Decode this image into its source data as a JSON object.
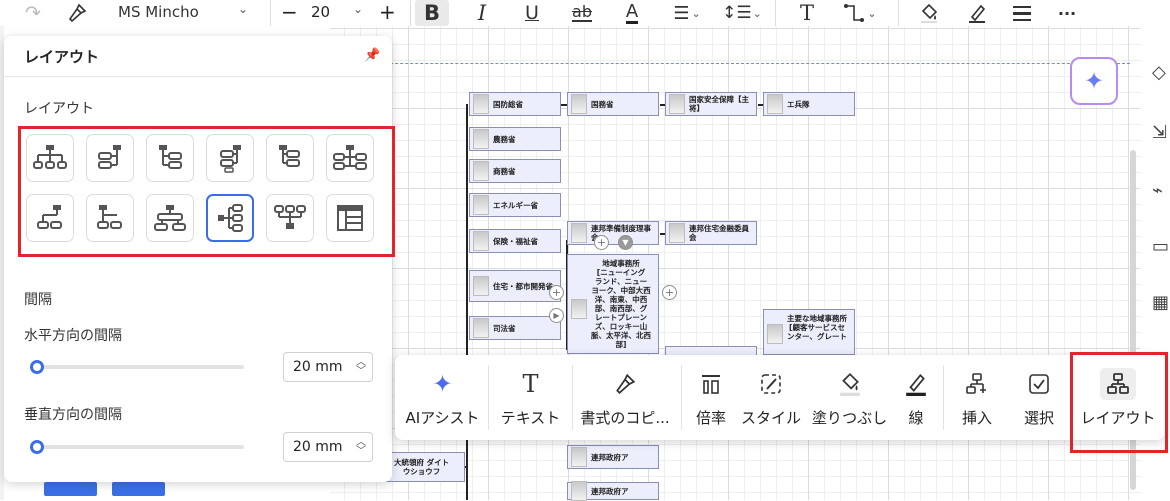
{
  "toolbar": {
    "font_name": "MS Mincho",
    "font_size": "20",
    "minus": "−",
    "plus": "+",
    "more": "···"
  },
  "panel": {
    "title": "レイアウト",
    "layout_section": "レイアウト",
    "spacing_section": "間隔",
    "horizontal_label": "水平方向の間隔",
    "horizontal_value": "20 mm",
    "vertical_label": "垂直方向の間隔",
    "vertical_value": "20 mm",
    "selected_layout_index": 9
  },
  "float_bar": {
    "items": [
      {
        "label": "AIアシスト",
        "icon": "sparkle-icon"
      },
      {
        "label": "テキスト",
        "icon": "text-icon"
      },
      {
        "label": "書式のコピ...",
        "icon": "format-painter-icon"
      },
      {
        "label": "倍率",
        "icon": "scale-icon"
      },
      {
        "label": "スタイル",
        "icon": "style-icon"
      },
      {
        "label": "塗りつぶし",
        "icon": "fill-icon"
      },
      {
        "label": "線",
        "icon": "line-icon"
      },
      {
        "label": "挿入",
        "icon": "insert-icon"
      },
      {
        "label": "選択",
        "icon": "select-icon"
      },
      {
        "label": "レイアウト",
        "icon": "layout-icon"
      }
    ]
  },
  "org_chart": {
    "left_nodes": [
      "国防総省",
      "農務省",
      "商務省",
      "エネルギー省",
      "保険・福祉省",
      "住宅・都市開発省",
      "司法省"
    ],
    "top_row": [
      "国務省",
      "国家安全保障【主\n将】",
      "エ兵隊"
    ],
    "middle_nodes": [
      "連邦準備制度理事会",
      "連邦住宅金融委員\n会"
    ],
    "big_node": "地域事務所\n[ニューイング\nランド、ニュー\nヨーク、中部大西\n洋、南東、中西\n部、南西部、グ\nレートプレーン\nズ、ロッキー山\n脈、太平洋、北西\n部]",
    "right_big_node": "主要な地域事務所\n[顧客サービスセ\nンター、グレート",
    "bottom_left_node": "大統領府 ダイト\nウショウフ",
    "bottom_nodes": [
      "連邦政府ア",
      "連邦政府ア"
    ]
  },
  "colors": {
    "accent": "#3a6ee8",
    "highlight": "#e0262d",
    "node_fill": "#eceefb",
    "node_border": "#8a8fb8"
  }
}
